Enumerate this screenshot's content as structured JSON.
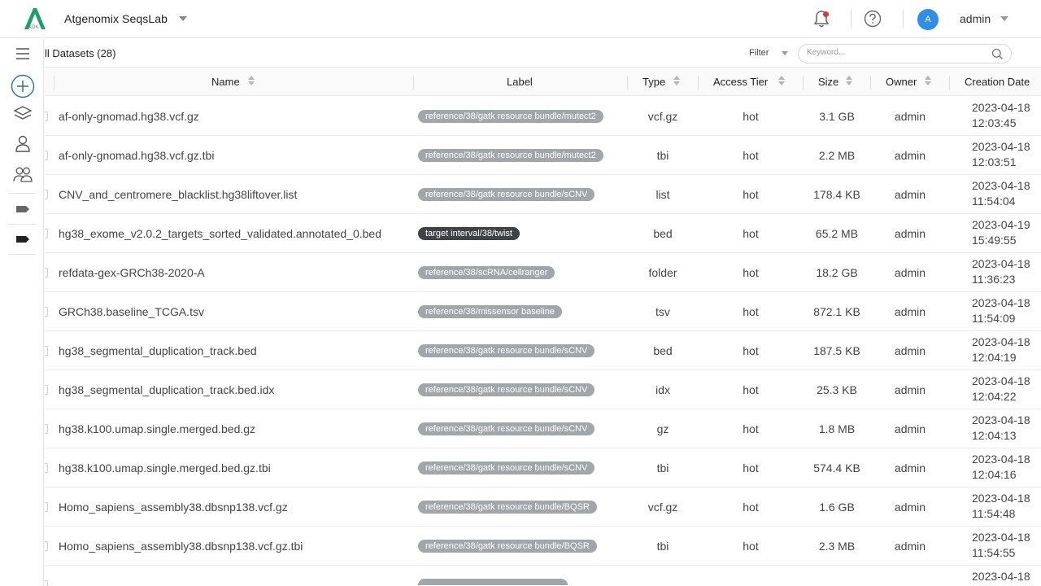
{
  "header": {
    "app_title": "Atgenomix SeqsLab",
    "logo_text": "XDK",
    "avatar_letter": "A",
    "user_name": "admin"
  },
  "toolbar": {
    "datasets_title": "ll Datasets (28)",
    "filter_label": "Filter",
    "search_placeholder": "Keyword..."
  },
  "columns": {
    "name": "Name",
    "label": "Label",
    "type": "Type",
    "access_tier": "Access Tier",
    "size": "Size",
    "owner": "Owner",
    "creation_date": "Creation Date"
  },
  "rows": [
    {
      "name": "af-only-gnomad.hg38.vcf.gz",
      "label": "reference/38/gatk resource bundle/mutect2",
      "label_style": "light",
      "type": "vcf.gz",
      "tier": "hot",
      "size": "3.1 GB",
      "owner": "admin",
      "date": "2023-04-18",
      "time": "12:03:45"
    },
    {
      "name": "af-only-gnomad.hg38.vcf.gz.tbi",
      "label": "reference/38/gatk resource bundle/mutect2",
      "label_style": "light",
      "type": "tbi",
      "tier": "hot",
      "size": "2.2 MB",
      "owner": "admin",
      "date": "2023-04-18",
      "time": "12:03:51"
    },
    {
      "name": "CNV_and_centromere_blacklist.hg38liftover.list",
      "label": "reference/38/gatk resource bundle/sCNV",
      "label_style": "light",
      "type": "list",
      "tier": "hot",
      "size": "178.4 KB",
      "owner": "admin",
      "date": "2023-04-18",
      "time": "11:54:04"
    },
    {
      "name": "hg38_exome_v2.0.2_targets_sorted_validated.annotated_0.bed",
      "label": "target interval/38/twist",
      "label_style": "dark",
      "type": "bed",
      "tier": "hot",
      "size": "65.2 MB",
      "owner": "admin",
      "date": "2023-04-19",
      "time": "15:49:55"
    },
    {
      "name": "refdata-gex-GRCh38-2020-A",
      "label": "reference/38/scRNA/cellranger",
      "label_style": "light",
      "type": "folder",
      "tier": "hot",
      "size": "18.2 GB",
      "owner": "admin",
      "date": "2023-04-18",
      "time": "11:36:23"
    },
    {
      "name": "GRCh38.baseline_TCGA.tsv",
      "label": "reference/38/missensor baseline",
      "label_style": "light",
      "type": "tsv",
      "tier": "hot",
      "size": "872.1 KB",
      "owner": "admin",
      "date": "2023-04-18",
      "time": "11:54:09"
    },
    {
      "name": "hg38_segmental_duplication_track.bed",
      "label": "reference/38/gatk resource bundle/sCNV",
      "label_style": "light",
      "type": "bed",
      "tier": "hot",
      "size": "187.5 KB",
      "owner": "admin",
      "date": "2023-04-18",
      "time": "12:04:19"
    },
    {
      "name": "hg38_segmental_duplication_track.bed.idx",
      "label": "reference/38/gatk resource bundle/sCNV",
      "label_style": "light",
      "type": "idx",
      "tier": "hot",
      "size": "25.3 KB",
      "owner": "admin",
      "date": "2023-04-18",
      "time": "12:04:22"
    },
    {
      "name": "hg38.k100.umap.single.merged.bed.gz",
      "label": "reference/38/gatk resource bundle/sCNV",
      "label_style": "light",
      "type": "gz",
      "tier": "hot",
      "size": "1.8 MB",
      "owner": "admin",
      "date": "2023-04-18",
      "time": "12:04:13"
    },
    {
      "name": "hg38.k100.umap.single.merged.bed.gz.tbi",
      "label": "reference/38/gatk resource bundle/sCNV",
      "label_style": "light",
      "type": "tbi",
      "tier": "hot",
      "size": "574.4 KB",
      "owner": "admin",
      "date": "2023-04-18",
      "time": "12:04:16"
    },
    {
      "name": "Homo_sapiens_assembly38.dbsnp138.vcf.gz",
      "label": "reference/38/gatk resource bundle/BQSR",
      "label_style": "light",
      "type": "vcf.gz",
      "tier": "hot",
      "size": "1.6 GB",
      "owner": "admin",
      "date": "2023-04-18",
      "time": "11:54:48"
    },
    {
      "name": "Homo_sapiens_assembly38.dbsnp138.vcf.gz.tbi",
      "label": "reference/38/gatk resource bundle/BQSR",
      "label_style": "light",
      "type": "tbi",
      "tier": "hot",
      "size": "2.3 MB",
      "owner": "admin",
      "date": "2023-04-18",
      "time": "11:54:55"
    },
    {
      "name": "",
      "label": "",
      "label_style": "light",
      "type": "",
      "tier": "",
      "size": "",
      "owner": "",
      "date": "2023-04-18",
      "time": ""
    }
  ],
  "colors": {
    "tag_light": "#a1a6ad",
    "tag_dark": "#3f4246",
    "accent_blue": "#2f8fe8",
    "logo_green": "#1e9e6a",
    "notification": "#e5322d"
  }
}
